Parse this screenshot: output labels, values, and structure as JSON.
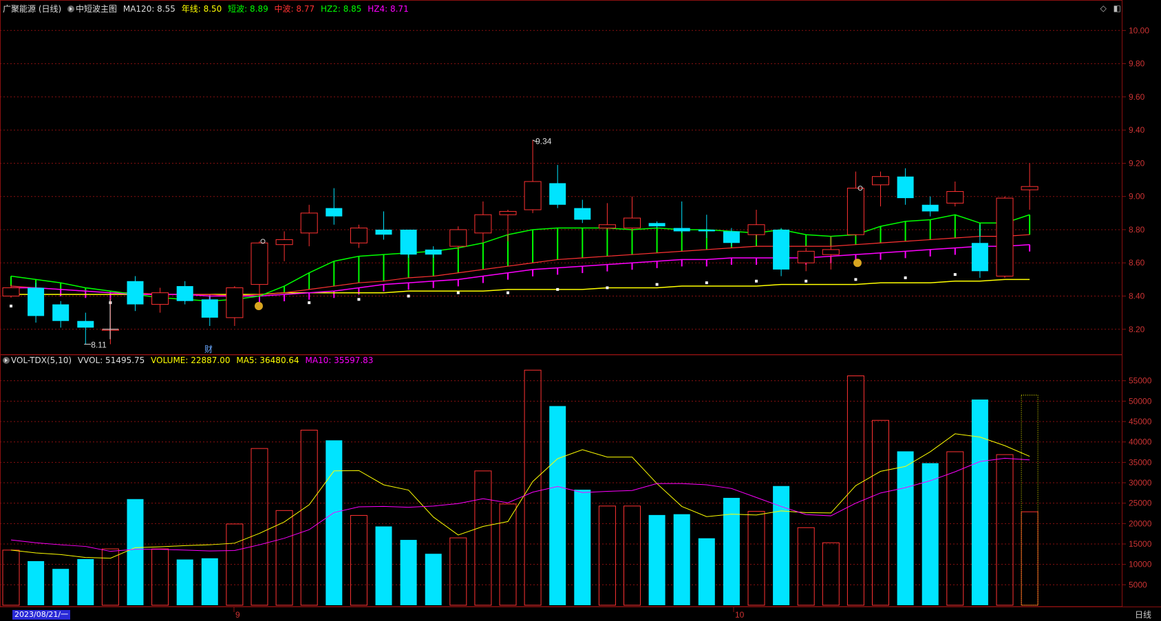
{
  "main_header": {
    "stock": "广聚能源 (日线)",
    "indicator": "中短波主图",
    "ma120": "MA120: 8.55",
    "nianxian": "年线: 8.50",
    "duanbo": "短波: 8.89",
    "zhongbo": "中波: 8.77",
    "hz2": "HZ2: 8.85",
    "hz4": "HZ4: 8.71"
  },
  "vol_header": {
    "name": "VOL-TDX(5,10)",
    "vvol": "VVOL: 51495.75",
    "volume": "VOLUME: 22887.00",
    "ma5": "MA5: 36480.64",
    "ma10": "MA10: 35597.83"
  },
  "toolbar_icons": [
    "diamond-icon",
    "window-icon"
  ],
  "price_axis_labels": [
    "10.00",
    "9.80",
    "9.60",
    "9.40",
    "9.20",
    "9.00",
    "8.80",
    "8.60",
    "8.40",
    "8.20"
  ],
  "volume_axis_labels": [
    "55000",
    "50000",
    "45000",
    "40000",
    "35000",
    "30000",
    "25000",
    "20000",
    "15000",
    "10000",
    "5000"
  ],
  "date_label": "2023/08/21/一",
  "month_labels": [
    "9",
    "10"
  ],
  "period_label": "日线",
  "annotations": {
    "high": "9.34",
    "low": "8.11",
    "finance_marker": "财"
  },
  "colors": {
    "up": "#ff3232",
    "down": "#00e4ff",
    "duanbo": "#00ff00",
    "zhongbo": "#ff3232",
    "hz4": "#ff00ff",
    "nianxian": "#ffff00",
    "ma5": "#ffff00",
    "ma10": "#ff00ff",
    "grid": "#8a1010",
    "text": "#dddddd"
  },
  "chart_data": {
    "type": "candlestick",
    "price_ylim": [
      8.05,
      10.08
    ],
    "volume_ylim": [
      0,
      60000
    ],
    "candles": [
      {
        "o": 8.4,
        "c": 8.45,
        "h": 8.47,
        "l": 8.39,
        "v": 13500
      },
      {
        "o": 8.45,
        "c": 8.28,
        "h": 8.48,
        "l": 8.24,
        "v": 10800
      },
      {
        "o": 8.35,
        "c": 8.25,
        "h": 8.37,
        "l": 8.21,
        "v": 8900
      },
      {
        "o": 8.25,
        "c": 8.21,
        "h": 8.3,
        "l": 8.11,
        "v": 11300
      },
      {
        "o": 8.2,
        "c": 8.2,
        "h": 8.39,
        "l": 8.11,
        "v": 13800
      },
      {
        "o": 8.49,
        "c": 8.35,
        "h": 8.52,
        "l": 8.31,
        "v": 26000
      },
      {
        "o": 8.35,
        "c": 8.42,
        "h": 8.45,
        "l": 8.3,
        "v": 13800
      },
      {
        "o": 8.46,
        "c": 8.37,
        "h": 8.49,
        "l": 8.35,
        "v": 11200
      },
      {
        "o": 8.38,
        "c": 8.27,
        "h": 8.4,
        "l": 8.22,
        "v": 11500
      },
      {
        "o": 8.27,
        "c": 8.45,
        "h": 8.46,
        "l": 8.22,
        "v": 19900
      },
      {
        "o": 8.47,
        "c": 8.72,
        "h": 8.73,
        "l": 8.4,
        "v": 38400
      },
      {
        "o": 8.71,
        "c": 8.74,
        "h": 8.79,
        "l": 8.61,
        "v": 23200
      },
      {
        "o": 8.78,
        "c": 8.9,
        "h": 8.95,
        "l": 8.7,
        "v": 42900
      },
      {
        "o": 8.93,
        "c": 8.88,
        "h": 9.05,
        "l": 8.83,
        "v": 40400
      },
      {
        "o": 8.72,
        "c": 8.81,
        "h": 8.83,
        "l": 8.69,
        "v": 22000
      },
      {
        "o": 8.8,
        "c": 8.77,
        "h": 8.91,
        "l": 8.74,
        "v": 19300
      },
      {
        "o": 8.8,
        "c": 8.65,
        "h": 8.8,
        "l": 8.63,
        "v": 16000
      },
      {
        "o": 8.68,
        "c": 8.65,
        "h": 8.7,
        "l": 8.63,
        "v": 12600
      },
      {
        "o": 8.7,
        "c": 8.8,
        "h": 8.82,
        "l": 8.68,
        "v": 16500
      },
      {
        "o": 8.78,
        "c": 8.89,
        "h": 8.97,
        "l": 8.72,
        "v": 32900
      },
      {
        "o": 8.89,
        "c": 8.91,
        "h": 8.92,
        "l": 8.73,
        "v": 24800
      },
      {
        "o": 8.92,
        "c": 9.09,
        "h": 9.34,
        "l": 8.9,
        "v": 57600
      },
      {
        "o": 9.08,
        "c": 8.95,
        "h": 9.19,
        "l": 8.93,
        "v": 48800
      },
      {
        "o": 8.93,
        "c": 8.86,
        "h": 8.98,
        "l": 8.84,
        "v": 28300
      },
      {
        "o": 8.81,
        "c": 8.83,
        "h": 8.96,
        "l": 8.8,
        "v": 24300
      },
      {
        "o": 8.81,
        "c": 8.87,
        "h": 9.0,
        "l": 8.79,
        "v": 24300
      },
      {
        "o": 8.84,
        "c": 8.82,
        "h": 8.85,
        "l": 8.81,
        "v": 22100
      },
      {
        "o": 8.81,
        "c": 8.79,
        "h": 8.97,
        "l": 8.78,
        "v": 22300
      },
      {
        "o": 8.8,
        "c": 8.79,
        "h": 8.89,
        "l": 8.75,
        "v": 16400
      },
      {
        "o": 8.79,
        "c": 8.72,
        "h": 8.81,
        "l": 8.7,
        "v": 26300
      },
      {
        "o": 8.77,
        "c": 8.83,
        "h": 8.92,
        "l": 8.74,
        "v": 23000
      },
      {
        "o": 8.8,
        "c": 8.56,
        "h": 8.81,
        "l": 8.52,
        "v": 29200
      },
      {
        "o": 8.6,
        "c": 8.67,
        "h": 8.69,
        "l": 8.55,
        "v": 19000
      },
      {
        "o": 8.65,
        "c": 8.68,
        "h": 8.76,
        "l": 8.56,
        "v": 15300
      },
      {
        "o": 8.77,
        "c": 9.05,
        "h": 9.15,
        "l": 8.76,
        "v": 56200
      },
      {
        "o": 9.07,
        "c": 9.12,
        "h": 9.15,
        "l": 8.94,
        "v": 45300
      },
      {
        "o": 9.12,
        "c": 8.99,
        "h": 9.17,
        "l": 8.95,
        "v": 37700
      },
      {
        "o": 8.95,
        "c": 8.91,
        "h": 9.0,
        "l": 8.88,
        "v": 34800
      },
      {
        "o": 8.96,
        "c": 9.03,
        "h": 9.09,
        "l": 8.94,
        "v": 37600
      },
      {
        "o": 8.72,
        "c": 8.55,
        "h": 8.83,
        "l": 8.51,
        "v": 50400
      },
      {
        "o": 8.52,
        "c": 8.99,
        "h": 9.0,
        "l": 8.51,
        "v": 36900
      },
      {
        "o": 9.04,
        "c": 9.06,
        "h": 9.2,
        "l": 8.92,
        "v": 22887
      }
    ],
    "series": [
      {
        "name": "短波",
        "key": "duanbo",
        "values": [
          8.52,
          8.5,
          8.48,
          8.45,
          8.43,
          8.41,
          8.39,
          8.38,
          8.37,
          8.38,
          8.4,
          8.46,
          8.54,
          8.61,
          8.64,
          8.65,
          8.66,
          8.67,
          8.69,
          8.72,
          8.77,
          8.8,
          8.81,
          8.81,
          8.81,
          8.8,
          8.81,
          8.8,
          8.8,
          8.79,
          8.78,
          8.8,
          8.77,
          8.76,
          8.77,
          8.82,
          8.85,
          8.86,
          8.89,
          8.84,
          8.84,
          8.89
        ]
      },
      {
        "name": "中波",
        "key": "zhongbo",
        "values": [
          8.46,
          8.45,
          8.44,
          8.43,
          8.42,
          8.42,
          8.41,
          8.41,
          8.41,
          8.4,
          8.41,
          8.42,
          8.44,
          8.46,
          8.48,
          8.49,
          8.51,
          8.52,
          8.54,
          8.56,
          8.58,
          8.6,
          8.62,
          8.63,
          8.64,
          8.65,
          8.66,
          8.67,
          8.68,
          8.69,
          8.7,
          8.7,
          8.7,
          8.7,
          8.71,
          8.72,
          8.73,
          8.74,
          8.75,
          8.76,
          8.76,
          8.77
        ]
      },
      {
        "name": "HZ4",
        "key": "hz4",
        "values": [
          8.45,
          8.45,
          8.44,
          8.43,
          8.42,
          8.41,
          8.41,
          8.41,
          8.4,
          8.4,
          8.4,
          8.41,
          8.42,
          8.43,
          8.45,
          8.47,
          8.48,
          8.49,
          8.5,
          8.52,
          8.54,
          8.56,
          8.57,
          8.58,
          8.59,
          8.6,
          8.61,
          8.62,
          8.62,
          8.63,
          8.63,
          8.63,
          8.63,
          8.64,
          8.65,
          8.66,
          8.67,
          8.68,
          8.69,
          8.7,
          8.7,
          8.71
        ]
      },
      {
        "name": "年线",
        "key": "nianxian",
        "values": [
          8.41,
          8.41,
          8.41,
          8.41,
          8.41,
          8.41,
          8.41,
          8.41,
          8.41,
          8.41,
          8.41,
          8.42,
          8.42,
          8.42,
          8.42,
          8.42,
          8.43,
          8.43,
          8.43,
          8.43,
          8.44,
          8.44,
          8.44,
          8.44,
          8.45,
          8.45,
          8.45,
          8.46,
          8.46,
          8.46,
          8.46,
          8.47,
          8.47,
          8.47,
          8.47,
          8.48,
          8.48,
          8.48,
          8.49,
          8.49,
          8.5,
          8.5
        ]
      },
      {
        "name": "MA120",
        "key": "ma120",
        "values": [
          8.34,
          8.34,
          8.34,
          8.35,
          8.36,
          8.36,
          8.36,
          8.35,
          8.35,
          8.35,
          8.35,
          8.35,
          8.36,
          8.37,
          8.38,
          8.39,
          8.4,
          8.41,
          8.42,
          8.42,
          8.42,
          8.43,
          8.44,
          8.44,
          8.45,
          8.46,
          8.47,
          8.47,
          8.48,
          8.48,
          8.49,
          8.49,
          8.49,
          8.5,
          8.5,
          8.51,
          8.51,
          8.52,
          8.53,
          8.53,
          8.54,
          8.55
        ]
      },
      {
        "name": "MA5",
        "key": "ma5",
        "values": [
          13500,
          12800,
          12400,
          11700,
          11500,
          14100,
          14300,
          14600,
          14800,
          15200,
          17600,
          20400,
          24600,
          32900,
          33000,
          29500,
          28200,
          21600,
          17200,
          19300,
          20500,
          30300,
          35900,
          38100,
          36300,
          36300,
          29800,
          24200,
          21700,
          22300,
          22100,
          23100,
          22700,
          22600,
          29300,
          32800,
          34000,
          37600,
          42000,
          41200,
          39100,
          36481
        ]
      },
      {
        "name": "MA10",
        "key": "ma10",
        "values": [
          16000,
          15300,
          14800,
          14400,
          13200,
          13700,
          13700,
          13500,
          13300,
          13400,
          14800,
          16400,
          18500,
          22700,
          24100,
          24200,
          24000,
          24300,
          24900,
          26100,
          25100,
          27700,
          29100,
          27600,
          27900,
          28100,
          29800,
          29800,
          29500,
          28600,
          26400,
          24200,
          22200,
          21900,
          25000,
          27500,
          28800,
          30500,
          32700,
          35200,
          36000,
          35598
        ]
      }
    ]
  }
}
